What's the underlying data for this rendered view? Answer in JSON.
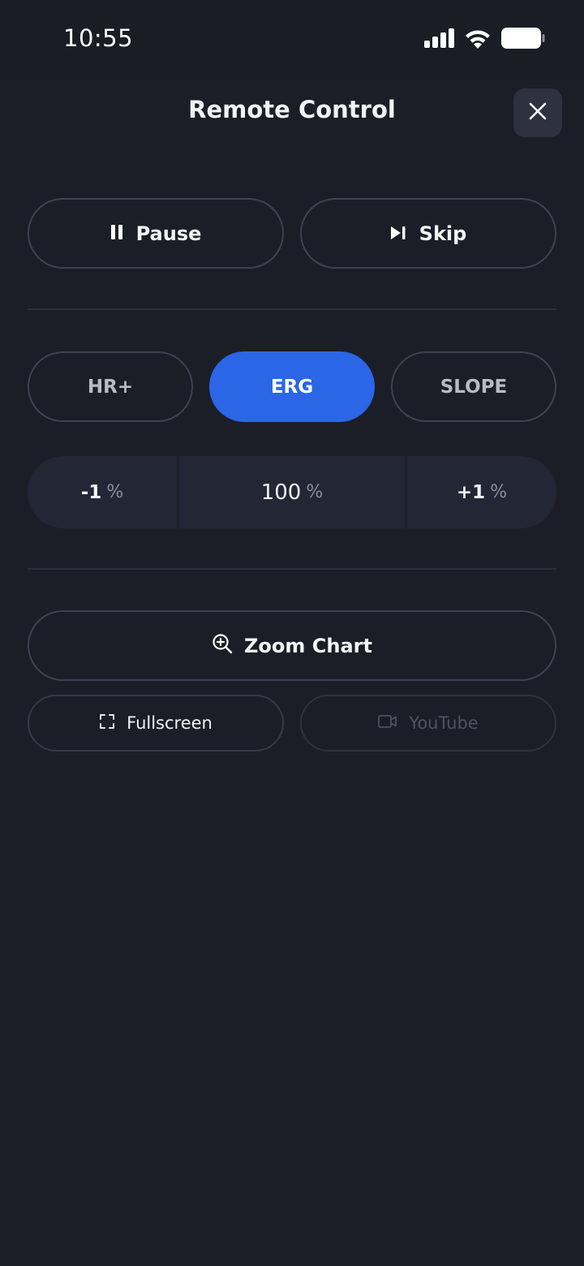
{
  "status_bar": {
    "time": "10:55",
    "icons": [
      "signal-icon",
      "wifi-icon",
      "battery-icon"
    ]
  },
  "header": {
    "title": "Remote Control",
    "close_icon": "close-icon"
  },
  "playback": {
    "pause_label": "Pause",
    "skip_label": "Skip"
  },
  "modes": [
    {
      "label": "HR+",
      "active": false
    },
    {
      "label": "ERG",
      "active": true
    },
    {
      "label": "SLOPE",
      "active": false
    }
  ],
  "intensity": {
    "decrease": {
      "value": "-1",
      "unit": "%"
    },
    "current": {
      "value": "100",
      "unit": "%"
    },
    "increase": {
      "value": "+1",
      "unit": "%"
    }
  },
  "view": {
    "zoom_label": "Zoom Chart",
    "fullscreen_label": "Fullscreen",
    "youtube_label": "YouTube",
    "youtube_enabled": false
  },
  "colors": {
    "background": "#1c1e27",
    "accent": "#2a66e6",
    "border": "#3f4252"
  }
}
